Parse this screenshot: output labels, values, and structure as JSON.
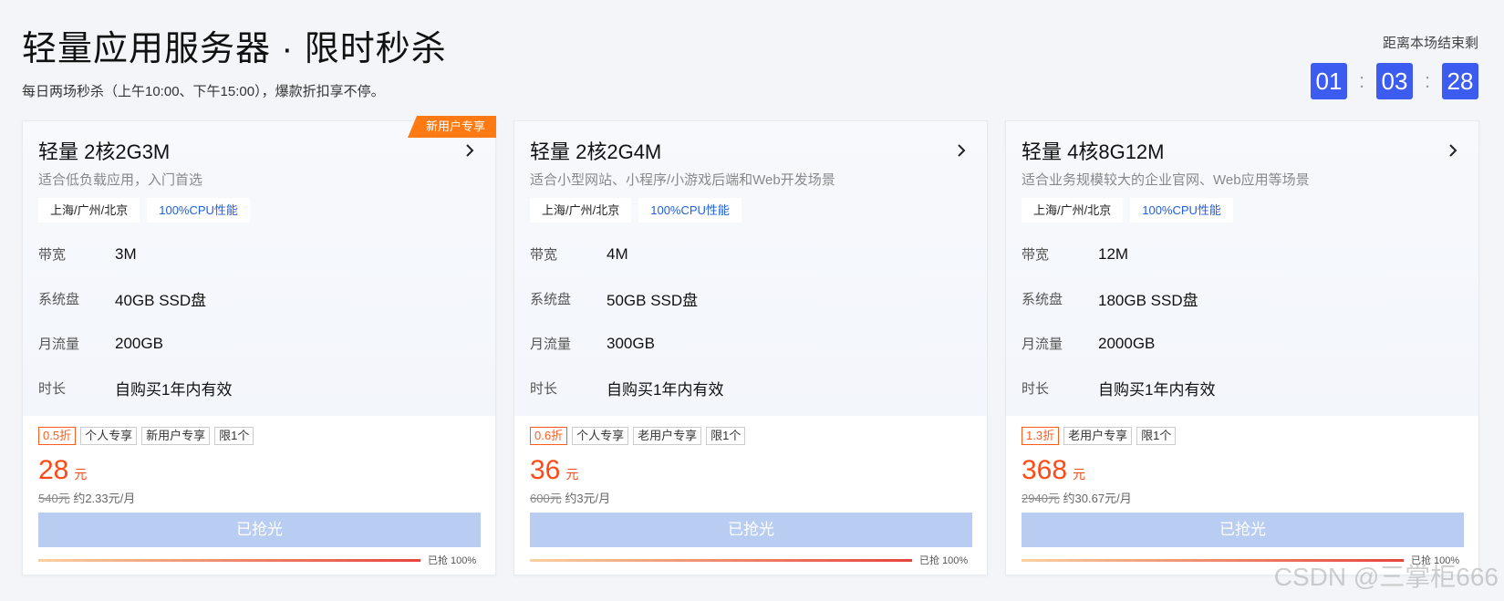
{
  "header": {
    "title": "轻量应用服务器 · 限时秒杀",
    "subtitle": "每日两场秒杀（上午10:00、下午15:00），爆款折扣享不停。"
  },
  "countdown": {
    "label": "距离本场结束剩",
    "hours": "01",
    "minutes": "03",
    "seconds": "28",
    "separator": ":"
  },
  "colors": {
    "accent": "#3c5cf0",
    "price": "#ff4a17",
    "ribbon": "#ff7a12",
    "sold_button": "#b9cdf2",
    "tag_blue": "#1f5fe0"
  },
  "cards": [
    {
      "ribbon": "新用户专享",
      "name": "轻量 2核2G3M",
      "desc": "适合低负载应用，入门首选",
      "tags": [
        "上海/广州/北京",
        "100%CPU性能"
      ],
      "specs": [
        {
          "k": "带宽",
          "v": "3M"
        },
        {
          "k": "系统盘",
          "v": "40GB SSD盘"
        },
        {
          "k": "月流量",
          "v": "200GB"
        },
        {
          "k": "时长",
          "v": "自购买1年内有效"
        }
      ],
      "badges": [
        "0.5折",
        "个人专享",
        "新用户专享",
        "限1个"
      ],
      "price": "28",
      "unit": "元",
      "orig": "540元",
      "monthly": "约2.33元/月",
      "button": "已抢光",
      "progress_text": "已抢 100%",
      "progress": 1.0
    },
    {
      "ribbon": "",
      "name": "轻量 2核2G4M",
      "desc": "适合小型网站、小程序/小游戏后端和Web开发场景",
      "tags": [
        "上海/广州/北京",
        "100%CPU性能"
      ],
      "specs": [
        {
          "k": "带宽",
          "v": "4M"
        },
        {
          "k": "系统盘",
          "v": "50GB SSD盘"
        },
        {
          "k": "月流量",
          "v": "300GB"
        },
        {
          "k": "时长",
          "v": "自购买1年内有效"
        }
      ],
      "badges": [
        "0.6折",
        "个人专享",
        "老用户专享",
        "限1个"
      ],
      "price": "36",
      "unit": "元",
      "orig": "600元",
      "monthly": "约3元/月",
      "button": "已抢光",
      "progress_text": "已抢 100%",
      "progress": 1.0
    },
    {
      "ribbon": "",
      "name": "轻量 4核8G12M",
      "desc": "适合业务规模较大的企业官网、Web应用等场景",
      "tags": [
        "上海/广州/北京",
        "100%CPU性能"
      ],
      "specs": [
        {
          "k": "带宽",
          "v": "12M"
        },
        {
          "k": "系统盘",
          "v": "180GB SSD盘"
        },
        {
          "k": "月流量",
          "v": "2000GB"
        },
        {
          "k": "时长",
          "v": "自购买1年内有效"
        }
      ],
      "badges": [
        "1.3折",
        "老用户专享",
        "限1个"
      ],
      "price": "368",
      "unit": "元",
      "orig": "2940元",
      "monthly": "约30.67元/月",
      "button": "已抢光",
      "progress_text": "已抢 100%",
      "progress": 1.0
    }
  ],
  "watermark": "CSDN @三掌柜666"
}
